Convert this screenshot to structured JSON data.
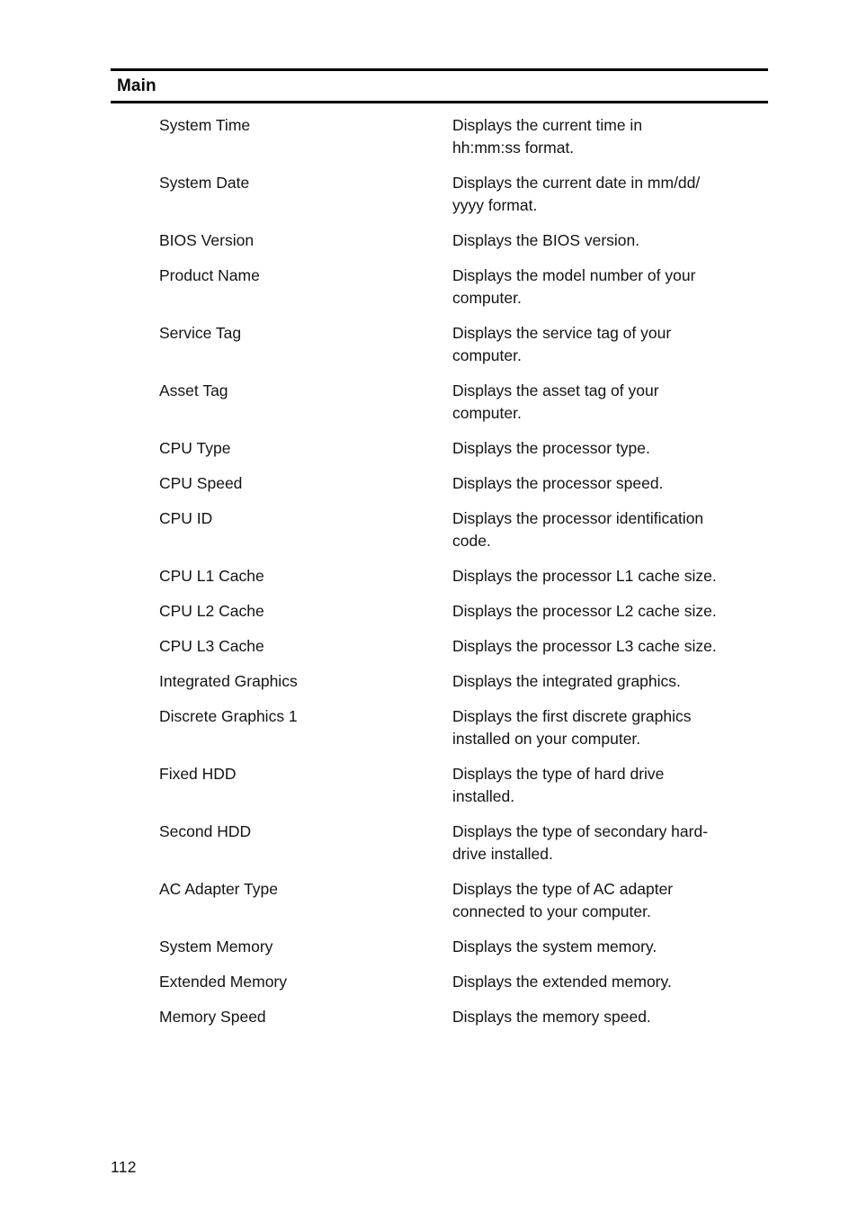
{
  "document": {
    "page_number": "112",
    "section": {
      "heading": "Main",
      "rows": [
        {
          "term": "System Time",
          "description": "Displays the current time in\nhh:mm:ss format."
        },
        {
          "term": "System Date",
          "description": "Displays the current date in mm/dd/\nyyyy format."
        },
        {
          "term": "BIOS Version",
          "description": "Displays the BIOS version."
        },
        {
          "term": "Product Name",
          "description": "Displays the model number of your\ncomputer."
        },
        {
          "term": "Service Tag",
          "description": "Displays the service tag of your\ncomputer."
        },
        {
          "term": "Asset Tag",
          "description": "Displays the asset tag of your\ncomputer."
        },
        {
          "term": "CPU Type",
          "description": "Displays the processor type."
        },
        {
          "term": "CPU Speed",
          "description": "Displays the processor speed."
        },
        {
          "term": "CPU ID",
          "description": "Displays the processor identification\ncode."
        },
        {
          "term": "CPU L1 Cache",
          "description": "Displays the processor L1 cache size."
        },
        {
          "term": "CPU L2 Cache",
          "description": "Displays the processor L2 cache size."
        },
        {
          "term": "CPU L3 Cache",
          "description": "Displays the processor L3 cache size."
        },
        {
          "term": "Integrated Graphics",
          "description": "Displays the integrated graphics."
        },
        {
          "term": "Discrete Graphics 1",
          "description": "Displays the first discrete graphics\ninstalled on your computer."
        },
        {
          "term": "Fixed HDD",
          "description": "Displays the type of hard drive\ninstalled."
        },
        {
          "term": "Second HDD",
          "description": "Displays the type of secondary hard-\ndrive installed."
        },
        {
          "term": "AC Adapter Type",
          "description": "Displays the type of AC adapter\nconnected to your computer."
        },
        {
          "term": "System Memory",
          "description": "Displays the system memory."
        },
        {
          "term": "Extended Memory",
          "description": "Displays the extended memory."
        },
        {
          "term": "Memory Speed",
          "description": "Displays the memory speed."
        }
      ]
    }
  }
}
